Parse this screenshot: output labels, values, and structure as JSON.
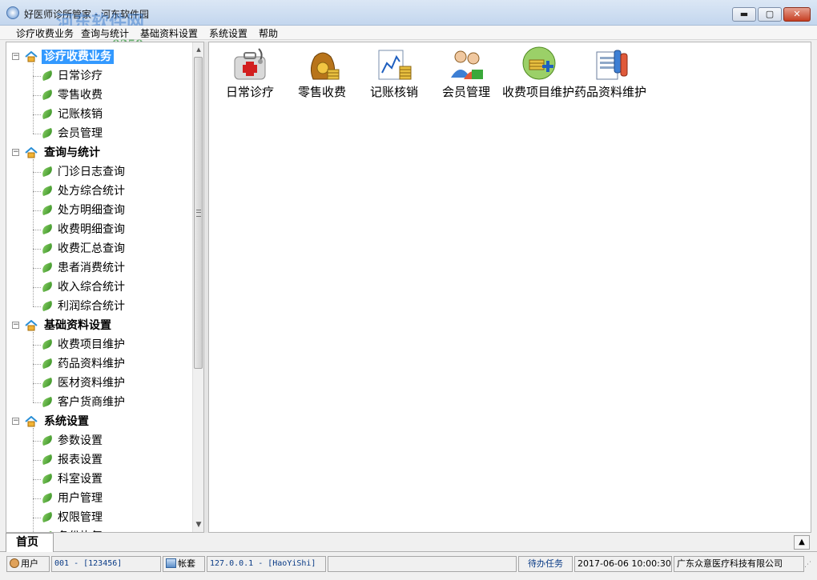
{
  "window": {
    "title": "好医师诊所管家 - 河东软件园",
    "watermark": "河东软件网",
    "watermark_url": "0359.cn",
    "min_label": "▬",
    "max_label": "▢",
    "close_label": "✕"
  },
  "menu": [
    "诊疗收费业务",
    "查询与统计",
    "基础资料设置",
    "系统设置",
    "帮助"
  ],
  "tree": [
    {
      "label": "诊疗收费业务",
      "selected": true,
      "items": [
        "日常诊疗",
        "零售收费",
        "记账核销",
        "会员管理"
      ]
    },
    {
      "label": "查询与统计",
      "selected": false,
      "items": [
        "门诊日志查询",
        "处方综合统计",
        "处方明细查询",
        "收费明细查询",
        "收费汇总查询",
        "患者消费统计",
        "收入综合统计",
        "利润综合统计"
      ]
    },
    {
      "label": "基础资料设置",
      "selected": false,
      "items": [
        "收费项目维护",
        "药品资料维护",
        "医材资料维护",
        "客户货商维护"
      ]
    },
    {
      "label": "系统设置",
      "selected": false,
      "items": [
        "参数设置",
        "报表设置",
        "科室设置",
        "用户管理",
        "权限管理",
        "备份恢复"
      ]
    }
  ],
  "tiles": [
    {
      "label": "日常诊疗",
      "icon": "medical-kit-icon"
    },
    {
      "label": "零售收费",
      "icon": "money-bag-icon"
    },
    {
      "label": "记账核销",
      "icon": "ledger-chart-icon"
    },
    {
      "label": "会员管理",
      "icon": "members-icon"
    },
    {
      "label": "收费项目维护",
      "icon": "coins-add-icon"
    },
    {
      "label": "药品资料维护",
      "icon": "drug-data-icon"
    }
  ],
  "tabs": {
    "home": "首页"
  },
  "status": {
    "user_label": "用户",
    "user_value": "001 - [123456]",
    "account_label": "帐套",
    "server_value": "127.0.0.1 - [HaoYiShi]",
    "blank": "",
    "pending_tasks": "待办任务",
    "datetime": "2017-06-06 10:00:30",
    "company": "广东众意医疗科技有限公司"
  },
  "colors": {
    "selection": "#3399ff",
    "status_text": "#0a3b86"
  }
}
